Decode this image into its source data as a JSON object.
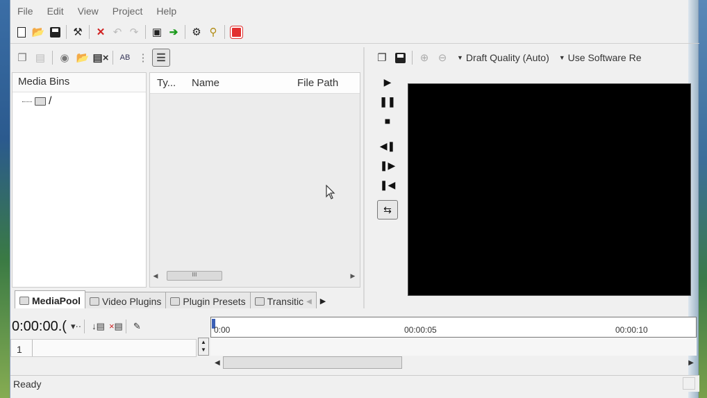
{
  "menu": [
    "File",
    "Edit",
    "View",
    "Project",
    "Help"
  ],
  "toolbar_icons": [
    "new-icon",
    "open-icon",
    "save-icon",
    "hammer-icon",
    "delete-icon",
    "undo-icon",
    "redo-icon",
    "export-icon",
    "go-icon",
    "settings-icon",
    "info-icon",
    "record-icon"
  ],
  "media_pool": {
    "bins_header": "Media Bins",
    "root_folder": "/",
    "columns": [
      "Ty...",
      "Name",
      "File Path"
    ],
    "scroll_thumb_label": "III"
  },
  "tabs": [
    {
      "label": "MediaPool",
      "active": true
    },
    {
      "label": "Video Plugins",
      "active": false
    },
    {
      "label": "Plugin Presets",
      "active": false
    },
    {
      "label": "Transitic",
      "active": false
    }
  ],
  "preview": {
    "quality": "Draft Quality (Auto)",
    "renderer": "Use Software Re"
  },
  "timeline": {
    "timecode": "0:00:00.(",
    "ruler_labels": [
      "0:00",
      "00:00:05",
      "00:00:10"
    ],
    "track_number": "1"
  },
  "status": "Ready",
  "colors": {
    "record_red": "#e23030",
    "go_green": "#1a9a1a",
    "playhead": "#3b5fb5"
  }
}
